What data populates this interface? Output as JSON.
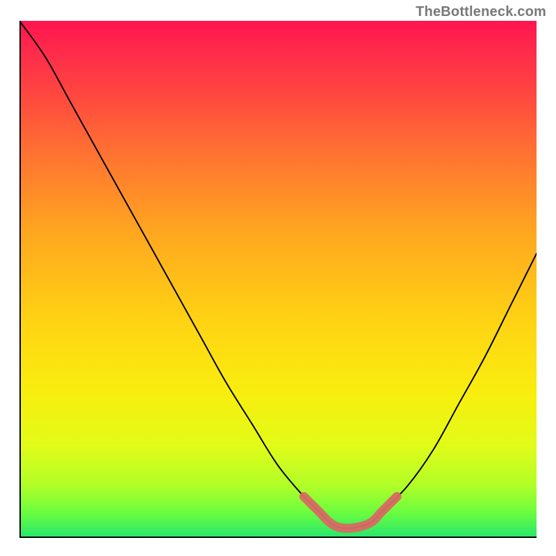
{
  "attribution": "TheBottleneck.com",
  "chart_data": {
    "type": "line",
    "title": "",
    "xlabel": "",
    "ylabel": "",
    "xlim": [
      0,
      100
    ],
    "ylim": [
      0,
      100
    ],
    "series": [
      {
        "name": "bottleneck-curve",
        "x": [
          0,
          5,
          10,
          15,
          20,
          25,
          30,
          35,
          40,
          45,
          50,
          55,
          58,
          60,
          62,
          65,
          68,
          70,
          75,
          80,
          85,
          90,
          95,
          100
        ],
        "y": [
          100,
          93,
          84,
          75,
          66,
          57,
          48,
          39,
          30,
          22,
          14,
          8,
          5,
          3,
          2,
          2,
          3,
          5,
          10,
          17,
          26,
          35,
          45,
          55
        ]
      },
      {
        "name": "optimal-range-highlight",
        "x": [
          55,
          58,
          60,
          62,
          65,
          68,
          70,
          73
        ],
        "y": [
          8,
          5,
          3,
          2,
          2,
          3,
          5,
          8
        ]
      }
    ],
    "gradient_stops": [
      {
        "pos": 0.0,
        "color": "#ff1550"
      },
      {
        "pos": 0.14,
        "color": "#ff4640"
      },
      {
        "pos": 0.4,
        "color": "#ffa420"
      },
      {
        "pos": 0.72,
        "color": "#f8ee0e"
      },
      {
        "pos": 0.9,
        "color": "#b0ff28"
      },
      {
        "pos": 1.0,
        "color": "#26e66e"
      }
    ]
  }
}
